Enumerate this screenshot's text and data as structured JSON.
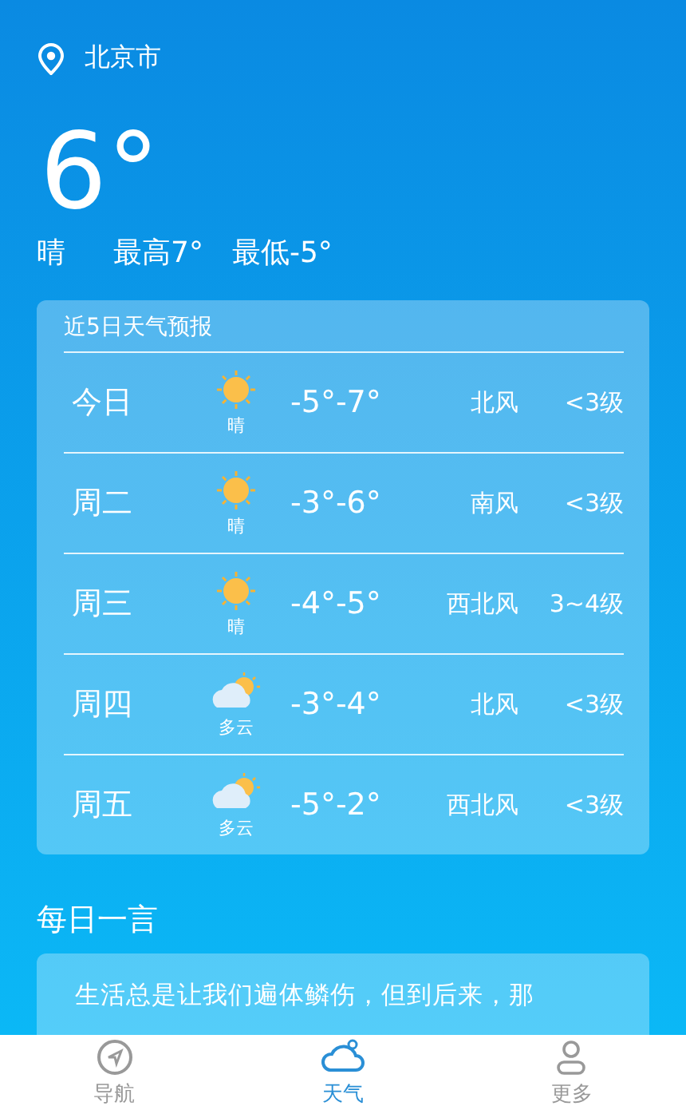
{
  "location": "北京市",
  "current": {
    "temperature": "6°",
    "condition": "晴",
    "high": "最高7°",
    "low": "最低-5°"
  },
  "forecast": {
    "title": "近5日天气预报",
    "days": [
      {
        "day": "今日",
        "kind": "sunny",
        "condition": "晴",
        "temps": "-5°-7°",
        "wind": "北风",
        "wind_level": "<3级"
      },
      {
        "day": "周二",
        "kind": "sunny",
        "condition": "晴",
        "temps": "-3°-6°",
        "wind": "南风",
        "wind_level": "<3级"
      },
      {
        "day": "周三",
        "kind": "sunny",
        "condition": "晴",
        "temps": "-4°-5°",
        "wind": "西北风",
        "wind_level": "3~4级"
      },
      {
        "day": "周四",
        "kind": "cloudy",
        "condition": "多云",
        "temps": "-3°-4°",
        "wind": "北风",
        "wind_level": "<3级"
      },
      {
        "day": "周五",
        "kind": "cloudy",
        "condition": "多云",
        "temps": "-5°-2°",
        "wind": "西北风",
        "wind_level": "<3级"
      }
    ]
  },
  "daily_quote": {
    "title": "每日一言",
    "text": "生活总是让我们遍体鳞伤，但到后来，那"
  },
  "nav": [
    {
      "label": "导航",
      "kind": "compass",
      "selected": false
    },
    {
      "label": "天气",
      "kind": "weather",
      "selected": true
    },
    {
      "label": "更多",
      "kind": "person",
      "selected": false
    }
  ]
}
